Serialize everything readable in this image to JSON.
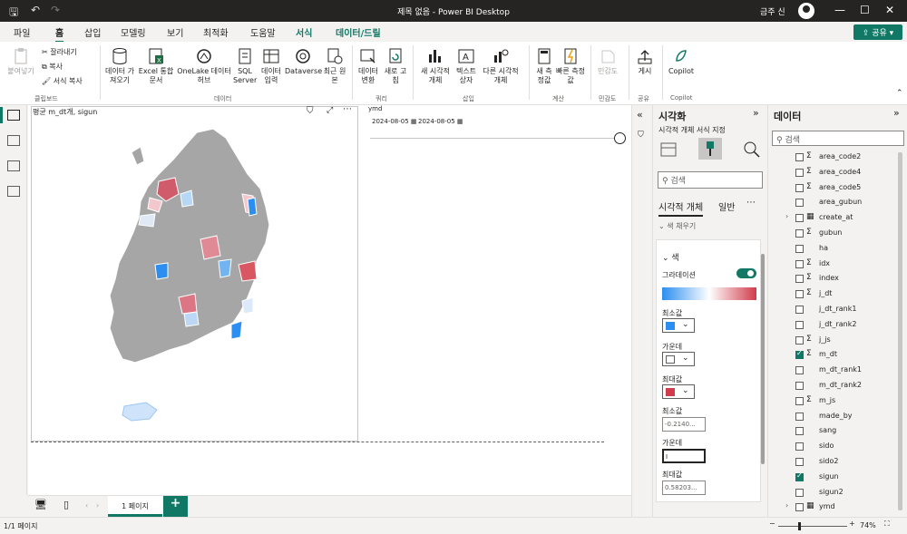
{
  "window": {
    "title": "제목 없음 - Power BI Desktop",
    "user": "금주 신"
  },
  "tabs": [
    "파일",
    "홈",
    "삽입",
    "모델링",
    "보기",
    "최적화",
    "도움말",
    "서식",
    "데이터/드릴"
  ],
  "share_label": "공유",
  "ribbon": {
    "clipboard": {
      "paste": "붙여넣기",
      "cut": "잘라내기",
      "copy": "복사",
      "format_copy": "서식 복사",
      "group": "클립보드"
    },
    "data": {
      "get_data": "데이터 가져오기",
      "excel": "Excel 통합 문서",
      "onelake": "OneLake 데이터 허브",
      "sql": "SQL Server",
      "enter": "데이터 입력",
      "dataverse": "Dataverse",
      "recent": "최근 원본",
      "group": "데이터"
    },
    "query": {
      "transform": "데이터 변환",
      "refresh": "새로 고침",
      "group": "쿼리"
    },
    "insert": {
      "new_visual": "새 시각적 개체",
      "textbox": "텍스트 상자",
      "more_visuals": "다른 시각적 개체",
      "group": "삽입"
    },
    "calc": {
      "new_measure": "새 측정값",
      "quick_measure": "빠른 측정값",
      "group": "계산"
    },
    "sensitivity": {
      "label": "민감도",
      "group": "민감도"
    },
    "share": {
      "publish": "게시",
      "group": "공유"
    },
    "copilot": {
      "label": "Copilot",
      "group": "Copilot"
    }
  },
  "visual": {
    "title": "평균 m_dt개, sigun"
  },
  "slicer": {
    "label": "ymd",
    "start": "2024-08-05",
    "end": "2024-08-05"
  },
  "page": {
    "tab": "1 페이지",
    "status": "1/1 페이지",
    "zoom": "74%"
  },
  "viz_panel": {
    "title": "시각화",
    "subtitle": "시각적 개체 서식 지정",
    "search_placeholder": "검색",
    "tab_visual": "시각적 개체",
    "tab_general": "일반",
    "section_prev": "색 채우기",
    "section": "색",
    "gradient_label": "그라데이션",
    "min_label": "최소값",
    "mid_label": "가운데",
    "max_label": "최대값",
    "min_value_label": "최소값",
    "min_value": "-0.2140...",
    "mid_value_label": "가운데",
    "max_value_label": "최대값",
    "max_value": "0.58203...",
    "colors": {
      "min": "#2b8ef0",
      "mid": "#ffffff",
      "max": "#d13b4b"
    }
  },
  "data_panel": {
    "title": "데이터",
    "search_placeholder": "검색",
    "fields": [
      {
        "name": "area_code2",
        "sigma": true,
        "checked": false,
        "table": false
      },
      {
        "name": "area_code4",
        "sigma": true,
        "checked": false,
        "table": false
      },
      {
        "name": "area_code5",
        "sigma": true,
        "checked": false,
        "table": false
      },
      {
        "name": "area_gubun",
        "sigma": false,
        "checked": false,
        "table": false
      },
      {
        "name": "create_at",
        "sigma": false,
        "checked": false,
        "table": true
      },
      {
        "name": "gubun",
        "sigma": true,
        "checked": false,
        "table": false
      },
      {
        "name": "ha",
        "sigma": false,
        "checked": false,
        "table": false
      },
      {
        "name": "idx",
        "sigma": true,
        "checked": false,
        "table": false
      },
      {
        "name": "index",
        "sigma": true,
        "checked": false,
        "table": false
      },
      {
        "name": "j_dt",
        "sigma": true,
        "checked": false,
        "table": false
      },
      {
        "name": "j_dt_rank1",
        "sigma": false,
        "checked": false,
        "table": false
      },
      {
        "name": "j_dt_rank2",
        "sigma": false,
        "checked": false,
        "table": false
      },
      {
        "name": "j_js",
        "sigma": true,
        "checked": false,
        "table": false
      },
      {
        "name": "m_dt",
        "sigma": true,
        "checked": true,
        "table": false
      },
      {
        "name": "m_dt_rank1",
        "sigma": false,
        "checked": false,
        "table": false
      },
      {
        "name": "m_dt_rank2",
        "sigma": false,
        "checked": false,
        "table": false
      },
      {
        "name": "m_js",
        "sigma": true,
        "checked": false,
        "table": false
      },
      {
        "name": "made_by",
        "sigma": false,
        "checked": false,
        "table": false
      },
      {
        "name": "sang",
        "sigma": false,
        "checked": false,
        "table": false
      },
      {
        "name": "sido",
        "sigma": false,
        "checked": false,
        "table": false
      },
      {
        "name": "sido2",
        "sigma": false,
        "checked": false,
        "table": false
      },
      {
        "name": "sigun",
        "sigma": false,
        "checked": true,
        "table": false
      },
      {
        "name": "sigun2",
        "sigma": false,
        "checked": false,
        "table": false
      },
      {
        "name": "ymd",
        "sigma": false,
        "checked": false,
        "table": true
      }
    ]
  }
}
